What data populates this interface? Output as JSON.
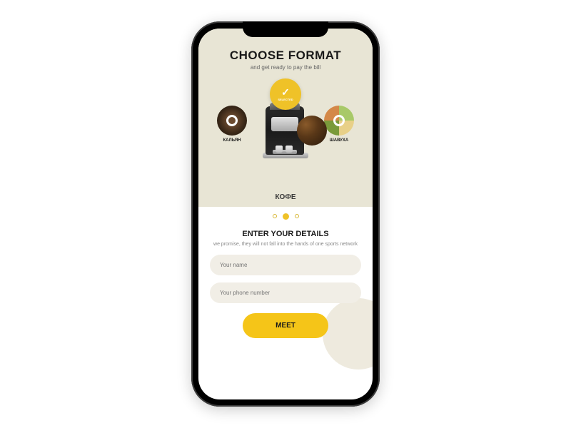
{
  "header": {
    "title": "CHOOSE FORMAT",
    "subtitle": "and get ready to pay the bill"
  },
  "formats": {
    "left": {
      "label": "КАЛЬЯН"
    },
    "center": {
      "selected_badge": "SELECTED",
      "label": "КОФЕ"
    },
    "right": {
      "label": "ШАВУХА"
    }
  },
  "carousel": {
    "active_index": 1,
    "count": 3
  },
  "form": {
    "title": "ENTER YOUR DETAILS",
    "subtitle": "we promise, they will not fall into the hands of one sports network",
    "name_placeholder": "Your name",
    "phone_placeholder": "Your phone number",
    "submit_label": "MEET"
  },
  "colors": {
    "accent": "#f5c518",
    "bg_top": "#e8e5d5"
  }
}
